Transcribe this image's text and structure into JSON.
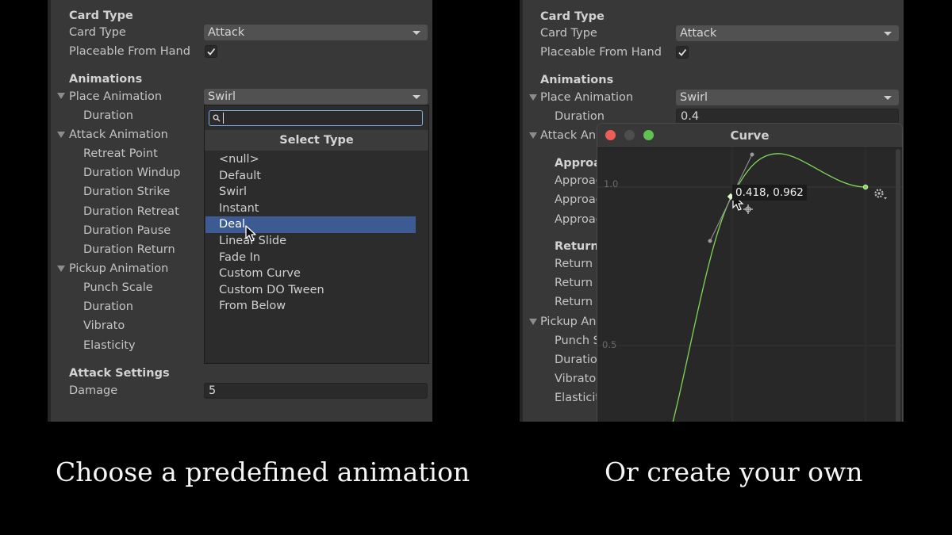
{
  "inspector": {
    "card_type_header": "Card Type",
    "card_type_label": "Card Type",
    "card_type_value": "Attack",
    "placeable_label": "Placeable From Hand",
    "placeable_checked": true,
    "animations_header": "Animations",
    "place_animation_label": "Place Animation",
    "place_animation_value": "Swirl",
    "duration_label": "Duration",
    "duration_value": "0.4",
    "attack_animation_label": "Attack Animation",
    "attack_fields": [
      "Retreat Point",
      "Duration Windup",
      "Duration Strike",
      "Duration Retreat",
      "Duration Pause",
      "Duration Return"
    ],
    "pickup_animation_label": "Pickup Animation",
    "pickup_fields": [
      "Punch Scale",
      "Duration",
      "Vibrato",
      "Elasticity"
    ],
    "attack_settings_header": "Attack Settings",
    "damage_label": "Damage",
    "damage_value": "5"
  },
  "right_inspector": {
    "attack_truncated": "Attack Ani",
    "approach_header": "Approac",
    "approach_items": [
      "Approac",
      "Approac",
      "Approac"
    ],
    "return_header": "Return",
    "return_items": [
      "Return I",
      "Return I",
      "Return S"
    ],
    "pickup_truncated": "Pickup Ani",
    "pickup_items": [
      "Punch S",
      "Duratio",
      "Vibrato",
      "Elasticit"
    ]
  },
  "dropdown": {
    "title": "Select Type",
    "search_value": "",
    "options": [
      "<null>",
      "Default",
      "Swirl",
      "Instant",
      "Deal",
      "Linear Slide",
      "Fade In",
      "Custom Curve",
      "Custom DO Tween",
      "From Below"
    ],
    "selected_index": 4
  },
  "curve_window": {
    "title": "Curve",
    "y_labels": [
      "1.0",
      "0.5"
    ],
    "tooltip": "0.418, 0.962",
    "curve_color": "#7ed957"
  },
  "captions": {
    "left": "Choose a predefined animation",
    "right": "Or create your own"
  },
  "colors": {
    "panel_bg": "#383838",
    "selection": "#3b5b92",
    "search_border": "#7aa8ea"
  }
}
